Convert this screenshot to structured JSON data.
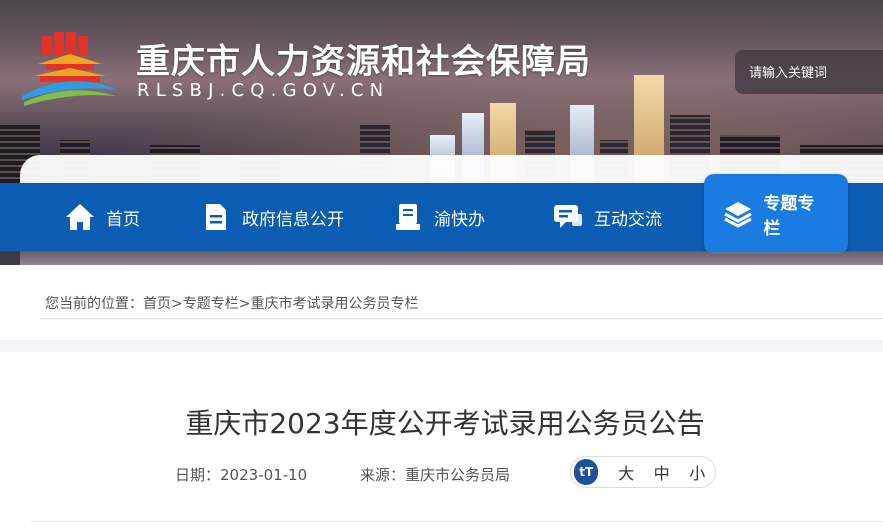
{
  "header": {
    "site_title": "重庆市人力资源和社会保障局",
    "site_domain": "RLSBJ.CQ.GOV.CN",
    "search_placeholder": "请输入关键词"
  },
  "nav": {
    "items": [
      {
        "label": "首页",
        "icon": "home-icon"
      },
      {
        "label": "政府信息公开",
        "icon": "document-icon"
      },
      {
        "label": "渝快办",
        "icon": "service-book-icon"
      },
      {
        "label": "互动交流",
        "icon": "chat-icon"
      },
      {
        "label": "专题专栏",
        "icon": "layers-icon",
        "active": true
      }
    ]
  },
  "breadcrumb": {
    "prefix": "您当前的位置：",
    "home": "首页",
    "sep1": ">",
    "section": "专题专栏",
    "sep2": ">",
    "current": "重庆市考试录用公务员专栏"
  },
  "article": {
    "title": "重庆市2023年度公开考试录用公务员公告",
    "date_label": "日期：",
    "date": "2023-01-10",
    "source_label": "来源：",
    "source": "重庆市公务员局",
    "font_icon": "tT",
    "font_large": "大",
    "font_medium": "中",
    "font_small": "小"
  },
  "colors": {
    "nav_bg": "#0b5cb3",
    "nav_active": "#1a7be0",
    "font_ctrl_badge": "#1d4f9c"
  }
}
